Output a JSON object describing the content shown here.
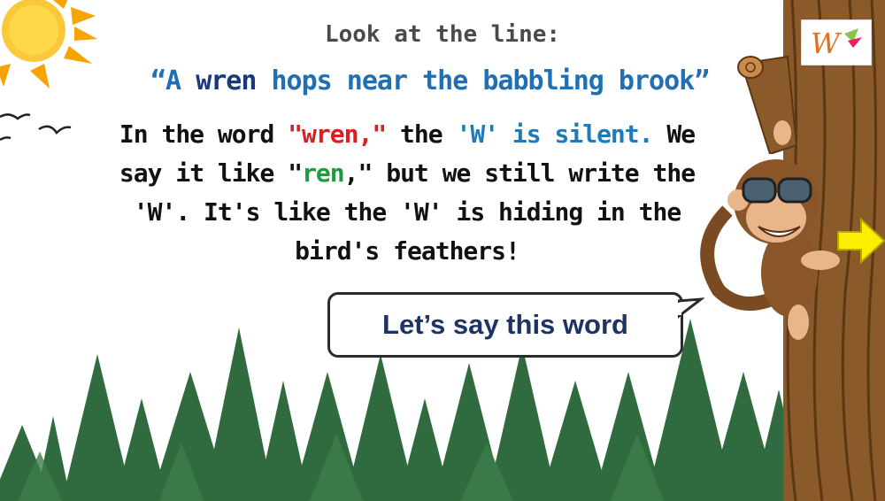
{
  "heading": "Look at the line:",
  "quote": {
    "open": "“A ",
    "word": "wren",
    "rest": " hops near the babbling brook”"
  },
  "paragraph": {
    "p1": "In the word ",
    "wren": "\"wren,\"",
    "p2": " the ",
    "silent": "'W' is silent.",
    "p3": " We say it like \"",
    "ren": "ren",
    "p4": ",\" but we still write the 'W'. It's like the 'W' is hiding in the bird's feathers!"
  },
  "button": {
    "label": "Let’s say this word"
  },
  "logo": {
    "text": "W"
  },
  "colors": {
    "red": "#d6211f",
    "blue": "#1f7ab8",
    "green": "#1f9a3c",
    "navy": "#1c3364"
  }
}
